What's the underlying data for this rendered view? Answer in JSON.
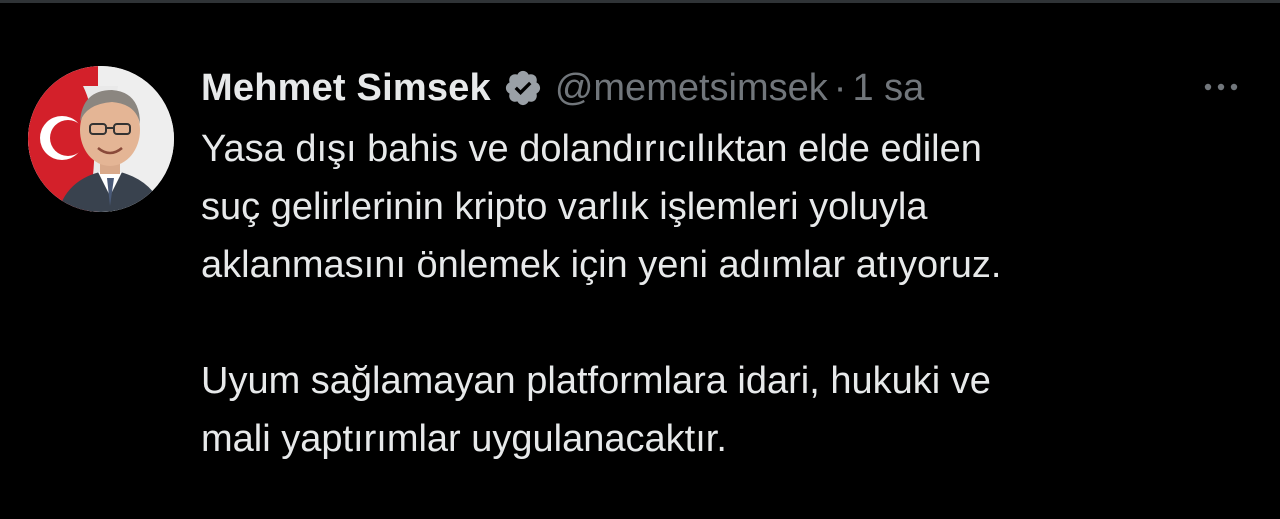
{
  "author": {
    "display_name": "Mehmet Simsek",
    "handle": "@memetsimsek",
    "separator": "·",
    "time": "1 sa"
  },
  "icons": {
    "verified": "verified-badge-icon",
    "more": "more-options-icon"
  },
  "tweet": {
    "paragraphs": [
      {
        "lines": [
          "Yasa dışı bahis ve dolandırıcılıktan elde edilen",
          "suç gelirlerinin kripto varlık işlemleri yoluyla",
          "aklanmasını önlemek için yeni adımlar atıyoruz."
        ]
      },
      {
        "lines": [
          "Uyum sağlamayan platformlara idari, hukuki ve",
          "mali yaptırımlar uygulanacaktır."
        ]
      }
    ]
  },
  "colors": {
    "background": "#000000",
    "text_primary": "#e7e9ea",
    "text_secondary": "#71767b",
    "verified_fill": "#9aa0a6"
  }
}
